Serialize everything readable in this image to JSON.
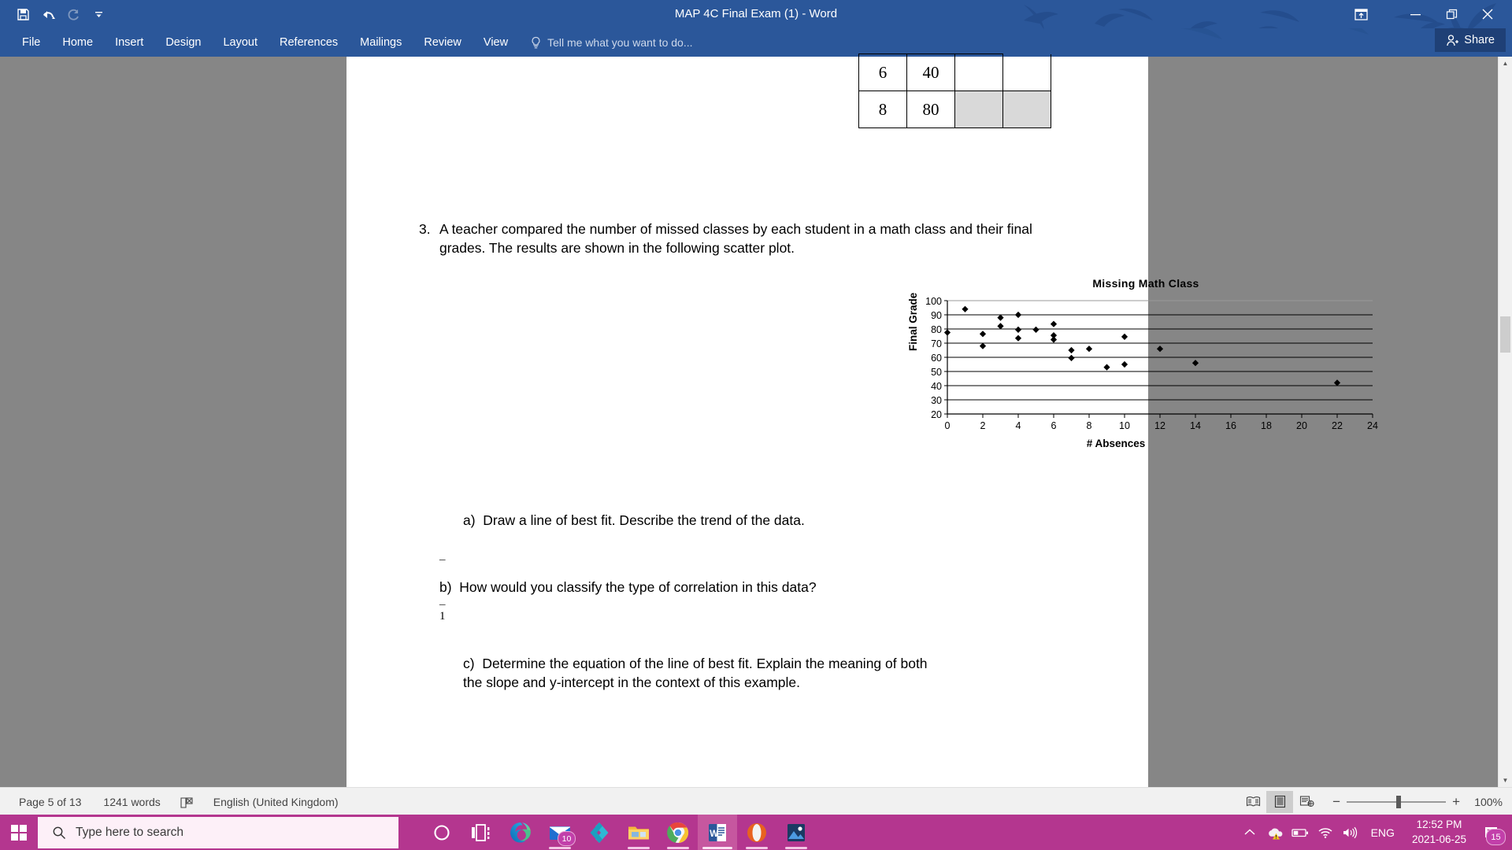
{
  "titlebar": {
    "title": "MAP 4C Final Exam (1) - Word",
    "quick_access": [
      {
        "name": "save-icon",
        "label": "Save"
      },
      {
        "name": "undo-icon",
        "label": "Undo"
      },
      {
        "name": "redo-icon",
        "label": "Redo"
      },
      {
        "name": "customize-quick-access-icon",
        "label": "Customize Quick Access Toolbar"
      }
    ],
    "window_controls": [
      {
        "name": "ribbon-display-options-icon",
        "label": "Ribbon Display Options"
      },
      {
        "name": "minimize-icon",
        "label": "Minimize"
      },
      {
        "name": "restore-icon",
        "label": "Restore Down"
      },
      {
        "name": "close-icon",
        "label": "Close"
      }
    ],
    "accent_color": "#2b579a",
    "share_label": "Share"
  },
  "ribbon": {
    "tabs": [
      "File",
      "Home",
      "Insert",
      "Design",
      "Layout",
      "References",
      "Mailings",
      "Review",
      "View"
    ],
    "tell_me_placeholder": "Tell me what you want to do..."
  },
  "document": {
    "table_fragment": {
      "rows": [
        {
          "cells": [
            "6",
            "40",
            "",
            ""
          ],
          "shaded": [
            false,
            false,
            false,
            false
          ]
        },
        {
          "cells": [
            "8",
            "80",
            "",
            ""
          ],
          "shaded": [
            false,
            false,
            true,
            true
          ]
        }
      ]
    },
    "question_number": "3.",
    "question_text": "A teacher compared the number of missed classes by each student in a math class and their final grades. The results are shown in the following scatter plot.",
    "parts": [
      {
        "label": "a)",
        "text": "Draw a line of best fit. Describe the trend of the data."
      },
      {
        "label": "b)",
        "text": "How would you classify the type of correlation in this data?"
      },
      {
        "label": "c)",
        "text": "Determine the equation of the line of best fit. Explain the meaning of both the slope and y-intercept in the context of this example."
      }
    ],
    "stray_marks": [
      {
        "name": "overline-mark-before-b",
        "text": "¯"
      },
      {
        "name": "overline-one-mark",
        "text": "1"
      }
    ]
  },
  "chart_data": {
    "type": "scatter",
    "title": "Missing Math Class",
    "xlabel": "# Absences",
    "ylabel": "Final Grade",
    "xlim": [
      0,
      24
    ],
    "ylim": [
      20,
      100
    ],
    "xticks": [
      0,
      2,
      4,
      6,
      8,
      10,
      12,
      14,
      16,
      18,
      20,
      22,
      24
    ],
    "yticks": [
      20,
      30,
      40,
      50,
      60,
      70,
      80,
      90,
      100
    ],
    "grid": "horizontal",
    "marker": "diamond",
    "marker_color": "#000000",
    "legend": "none",
    "points": [
      {
        "x": 0,
        "y": 77.5
      },
      {
        "x": 1,
        "y": 94
      },
      {
        "x": 2,
        "y": 76.5
      },
      {
        "x": 2,
        "y": 68
      },
      {
        "x": 3,
        "y": 88
      },
      {
        "x": 3,
        "y": 82
      },
      {
        "x": 4,
        "y": 90
      },
      {
        "x": 4,
        "y": 79.5
      },
      {
        "x": 4,
        "y": 73.5
      },
      {
        "x": 5,
        "y": 79.5
      },
      {
        "x": 6,
        "y": 83.5
      },
      {
        "x": 6,
        "y": 75.5
      },
      {
        "x": 6,
        "y": 72.5
      },
      {
        "x": 7,
        "y": 65
      },
      {
        "x": 7,
        "y": 59.5
      },
      {
        "x": 8,
        "y": 66
      },
      {
        "x": 9,
        "y": 53
      },
      {
        "x": 10,
        "y": 74.5
      },
      {
        "x": 10,
        "y": 55
      },
      {
        "x": 12,
        "y": 66
      },
      {
        "x": 14,
        "y": 56
      },
      {
        "x": 22,
        "y": 42
      }
    ]
  },
  "statusbar": {
    "page": "Page 5 of 13",
    "words": "1241 words",
    "proofing_icon": "spelling-and-grammar-check-icon",
    "language": "English (United Kingdom)",
    "views": [
      {
        "name": "read-mode-view-button",
        "label": "Read Mode",
        "active": false
      },
      {
        "name": "print-layout-view-button",
        "label": "Print Layout",
        "active": true
      },
      {
        "name": "web-layout-view-button",
        "label": "Web Layout",
        "active": false
      }
    ],
    "zoom_out_label": "−",
    "zoom_in_label": "+",
    "zoom_level": "100%"
  },
  "taskbar": {
    "start_label": "Start",
    "search_placeholder": "Type here to search",
    "accent_color": "#b4368f",
    "icons": [
      {
        "name": "cortana-icon",
        "label": "Cortana",
        "badge": null,
        "state": "none"
      },
      {
        "name": "task-view-icon",
        "label": "Task View",
        "badge": null,
        "state": "none"
      },
      {
        "name": "microsoft-edge-icon",
        "label": "Microsoft Edge",
        "badge": null,
        "state": "none"
      },
      {
        "name": "mail-icon",
        "label": "Mail",
        "badge": "10",
        "state": "running"
      },
      {
        "name": "kodi-icon",
        "label": "Kodi",
        "badge": null,
        "state": "none"
      },
      {
        "name": "file-explorer-icon",
        "label": "File Explorer",
        "badge": null,
        "state": "running"
      },
      {
        "name": "google-chrome-icon",
        "label": "Google Chrome",
        "badge": null,
        "state": "running"
      },
      {
        "name": "microsoft-word-icon",
        "label": "Microsoft Word",
        "badge": null,
        "state": "active"
      },
      {
        "name": "opera-icon",
        "label": "Opera",
        "badge": null,
        "state": "running"
      },
      {
        "name": "photos-icon",
        "label": "Photos",
        "badge": null,
        "state": "running"
      }
    ],
    "tray": [
      {
        "name": "show-hidden-icons-icon",
        "label": "Show hidden icons"
      },
      {
        "name": "onedrive-warning-icon",
        "label": "OneDrive"
      },
      {
        "name": "battery-icon",
        "label": "Battery"
      },
      {
        "name": "wifi-icon",
        "label": "Network"
      },
      {
        "name": "volume-icon",
        "label": "Volume"
      }
    ],
    "language": "ENG",
    "time": "12:52 PM",
    "date": "2021-06-25",
    "notification_badge": "15"
  }
}
